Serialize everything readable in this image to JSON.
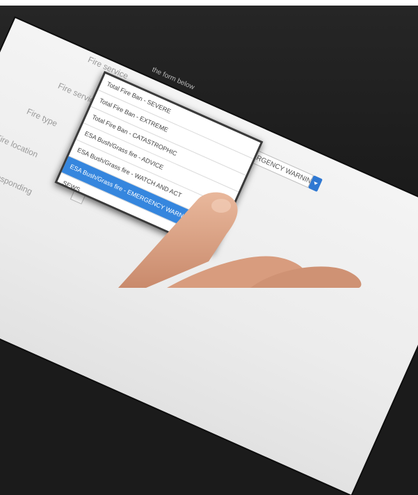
{
  "form": {
    "hint": "the form below",
    "labels": [
      "Fire service",
      "Fire service status",
      "Fire type",
      "Fire location",
      "No. of units responding"
    ],
    "status_select": {
      "value": "ESA Bush/Grass fire - EMERGENCY WARNING"
    }
  },
  "dropdown": {
    "options": [
      "Total Fire Ban - SEVERE",
      "Total Fire Ban - EXTREME",
      "Total Fire Ban - CATASTROPHIC",
      "ESA Bush/Grass fire - ADVICE",
      "ESA Bush/Grass fire - WATCH AND ACT",
      "ESA Bush/Grass fire - EMERGENCY WARNING",
      "SEWS"
    ],
    "selected": "ESA Bush/Grass fire - EMERGENCY WARNING"
  },
  "colors": {
    "accent": "#3586de",
    "screen": "#f0f0f0",
    "bezel": "#1b1b1b"
  }
}
